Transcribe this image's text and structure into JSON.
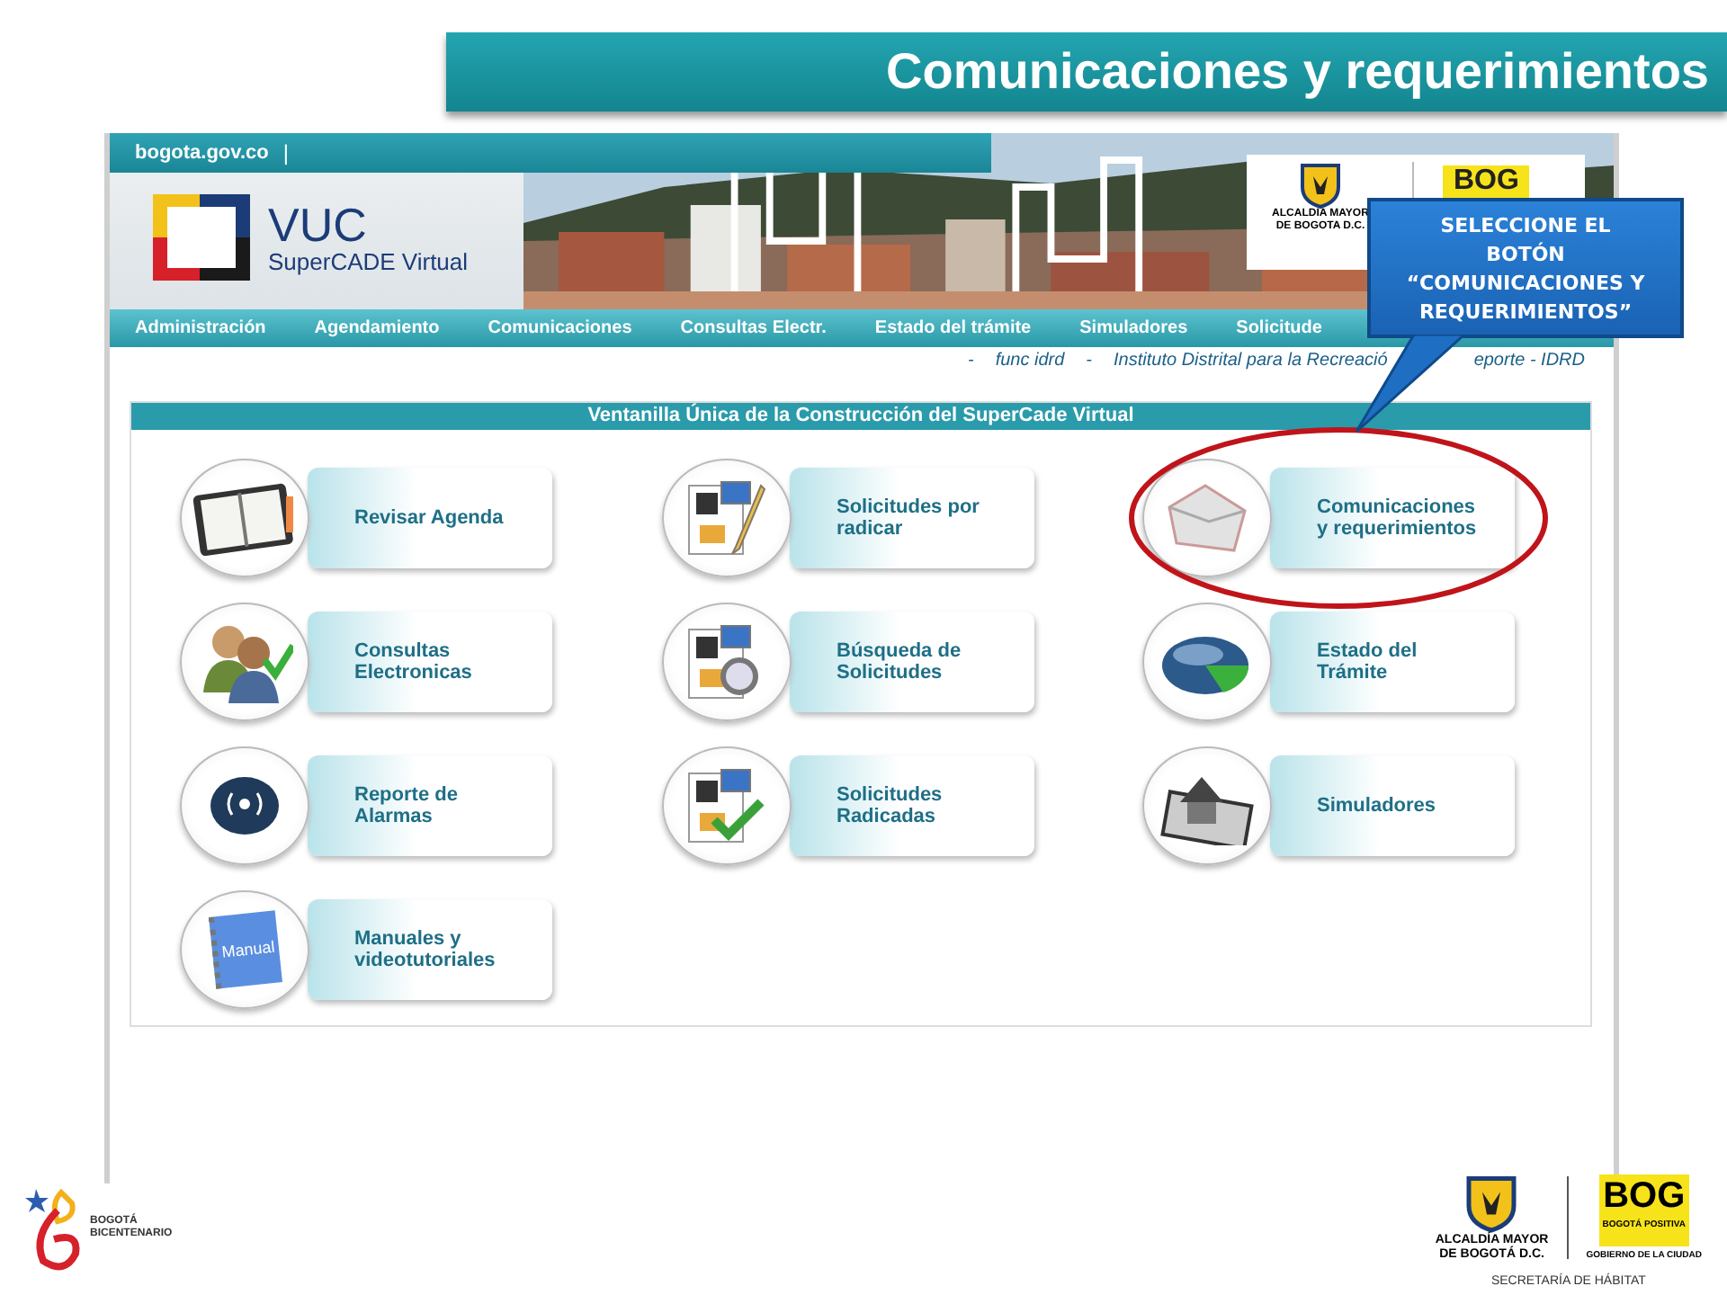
{
  "slide_title": "Comunicaciones y requerimientos",
  "site": {
    "domain": "bogota.gov.co",
    "divider": "|",
    "logo_title": "VUC",
    "logo_subtitle": "SuperCADE Virtual",
    "seal_lines": [
      "ALCALDIA MAYOR",
      "DE BOGOTA D.C."
    ],
    "brand": "BOG"
  },
  "nav": [
    "Administración",
    "Agendamiento",
    "Comunicaciones",
    "Consultas Electr.",
    "Estado del trámite",
    "Simuladores",
    "Solicitude"
  ],
  "sub_links": [
    "-",
    "func idrd",
    "-",
    "Instituto Distrital para la Recreació",
    "eporte - IDRD"
  ],
  "panel": {
    "title": "Ventanilla Única de la Construcción del SuperCade Virtual",
    "cards": [
      {
        "kind": "agenda",
        "lines": [
          "Revisar Agenda"
        ],
        "highlighted": false
      },
      {
        "kind": "documents",
        "lines": [
          "Solicitudes por",
          "radicar"
        ],
        "highlighted": false
      },
      {
        "kind": "envelope",
        "lines": [
          "Comunicaciones",
          "y requerimientos"
        ],
        "highlighted": true
      },
      {
        "kind": "people",
        "lines": [
          "Consultas",
          "Electronicas"
        ],
        "highlighted": false
      },
      {
        "kind": "search-documents",
        "lines": [
          "Búsqueda de",
          "Solicitudes"
        ],
        "highlighted": false
      },
      {
        "kind": "pie",
        "lines": [
          "Estado del",
          "Trámite"
        ],
        "highlighted": false
      },
      {
        "kind": "alarm",
        "lines": [
          "Reporte de",
          "Alarmas"
        ],
        "highlighted": false
      },
      {
        "kind": "check-documents",
        "lines": [
          "Solicitudes",
          "Radicadas"
        ],
        "highlighted": false
      },
      {
        "kind": "house",
        "lines": [
          "Simuladores"
        ],
        "highlighted": false
      },
      {
        "kind": "manual",
        "lines": [
          "Manuales y",
          "videotutoriales"
        ],
        "icon_text": "Manual",
        "highlighted": false
      }
    ]
  },
  "callout": {
    "lines": [
      "SELECCIONE EL",
      "BOTÓN",
      "“COMUNICACIONES Y",
      "REQUERIMIENTOS”"
    ]
  },
  "footer": {
    "left_lines": [
      "BOGOTÁ",
      "BICENTENARIO"
    ],
    "seal_lines": [
      "ALCALDÍA MAYOR",
      "DE BOGOTÁ D.C."
    ],
    "brand": "BOG",
    "brand_lines": [
      "BOGOTÁ",
      "POSITIVA"
    ],
    "brand_caption": "GOBIERNO DE LA CIUDAD",
    "department": "SECRETARÍA DE HÁBITAT"
  }
}
